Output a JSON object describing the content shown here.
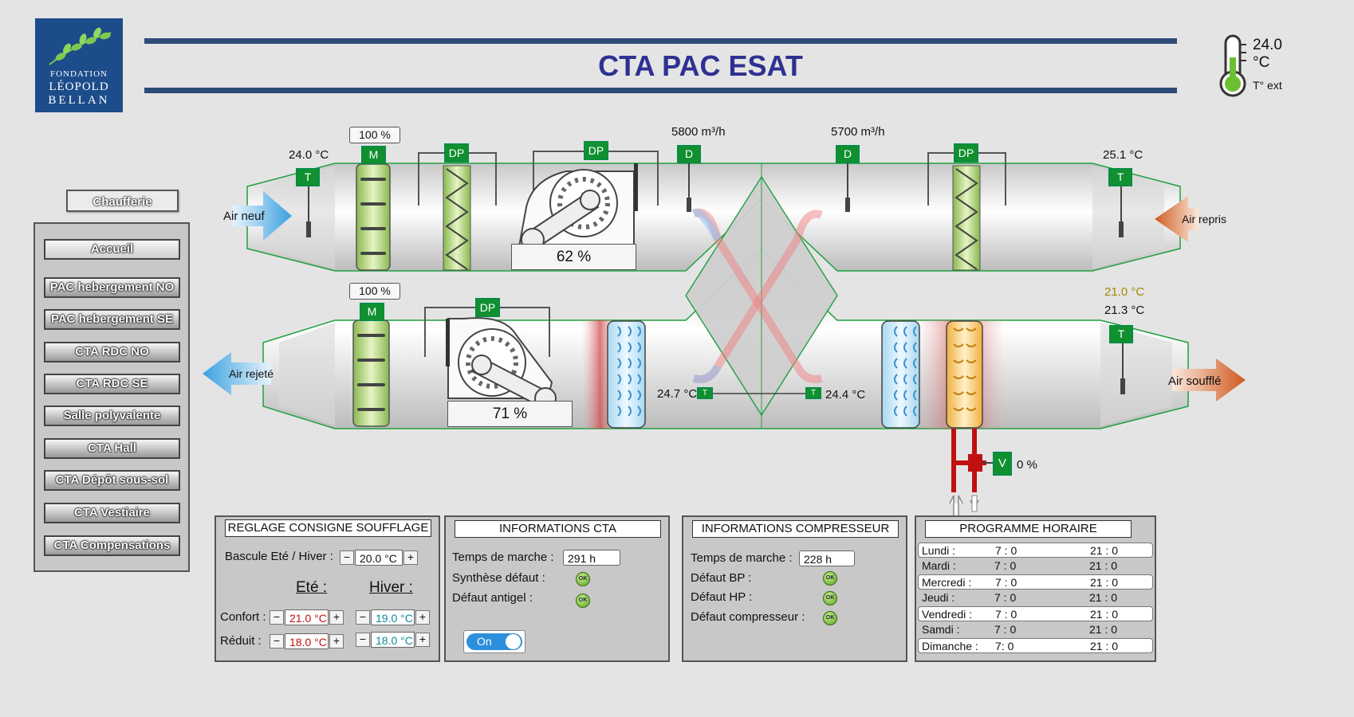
{
  "logo": {
    "line1": "FONDATION",
    "line2": "LÉOPOLD",
    "line3": "BELLAN"
  },
  "header": {
    "title": "CTA PAC ESAT"
  },
  "outside": {
    "temp": "24.0 °C",
    "label": "T° ext"
  },
  "nav": {
    "chaufferie": "Chaufferie",
    "items": [
      "Accueil",
      "PAC hebergement NO",
      "PAC hebergement SE",
      "CTA RDC NO",
      "CTA RDC SE",
      "Salle polyvalente",
      "CTA Hall",
      "CTA Dépôt sous-sol",
      "CTA Vestiaire",
      "CTA Compensations"
    ]
  },
  "diagram": {
    "air_neuf": "Air neuf",
    "air_repris": "Air repris",
    "air_rejete": "Air rejeté",
    "air_souffle": "Air soufflé",
    "temp_air_neuf": "24.0 °C",
    "temp_air_repris": "25.1 °C",
    "temp_consigne": "21.0 °C",
    "temp_souffle": "21.3 °C",
    "temp_recup_left": "24.7 °C",
    "temp_recup_right": "24.4 °C",
    "debit_1": "5800 m³/h",
    "debit_2": "5700 m³/h",
    "damper_top": "100 %",
    "damper_bottom": "100 %",
    "fan_top": "62 %",
    "fan_bottom": "71 %",
    "valve": "0 %",
    "badges": {
      "t": "T",
      "m": "M",
      "dp": "DP",
      "d": "D",
      "v": "V"
    },
    "colors": {
      "badge": "#109030",
      "title": "#2e3192",
      "header_line": "#2c4c78",
      "consigne": "#a08a00"
    }
  },
  "soufflage": {
    "title": "REGLAGE CONSIGNE SOUFFLAGE",
    "bascule_label": "Bascule Eté / Hiver :",
    "bascule_value": "20.0 °C",
    "ete": "Eté :",
    "hiver": "Hiver :",
    "confort_label": "Confort :",
    "confort_ete": "21.0 °C",
    "confort_hiver": "19.0 °C",
    "reduit_label": "Réduit :",
    "reduit_ete": "18.0 °C",
    "reduit_hiver": "18.0 °C",
    "minus": "−",
    "plus": "+"
  },
  "info_cta": {
    "title": "INFORMATIONS CTA",
    "temps_label": "Temps de marche :",
    "temps_value": "291 h",
    "synthese_label": "Synthèse défaut :",
    "antigel_label": "Défaut antigel :",
    "ok": "OK",
    "toggle": "On"
  },
  "info_comp": {
    "title": "INFORMATIONS COMPRESSEUR",
    "temps_label": "Temps de marche :",
    "temps_value": "228 h",
    "bp_label": "Défaut BP :",
    "hp_label": "Défaut HP :",
    "comp_label": "Défaut compresseur :",
    "ok": "OK"
  },
  "programme": {
    "title": "PROGRAMME HORAIRE",
    "rows": [
      {
        "day": "Lundi :",
        "start": "7 : 0",
        "end": "21 : 0"
      },
      {
        "day": "Mardi :",
        "start": "7 : 0",
        "end": "21 : 0"
      },
      {
        "day": "Mercredi :",
        "start": "7 : 0",
        "end": "21 : 0"
      },
      {
        "day": "Jeudi :",
        "start": "7 : 0",
        "end": "21 : 0"
      },
      {
        "day": "Vendredi :",
        "start": "7 : 0",
        "end": "21 : 0"
      },
      {
        "day": "Samdi :",
        "start": "7 : 0",
        "end": "21 : 0"
      },
      {
        "day": "Dimanche :",
        "start": "7:  0",
        "end": "21 : 0"
      }
    ]
  }
}
